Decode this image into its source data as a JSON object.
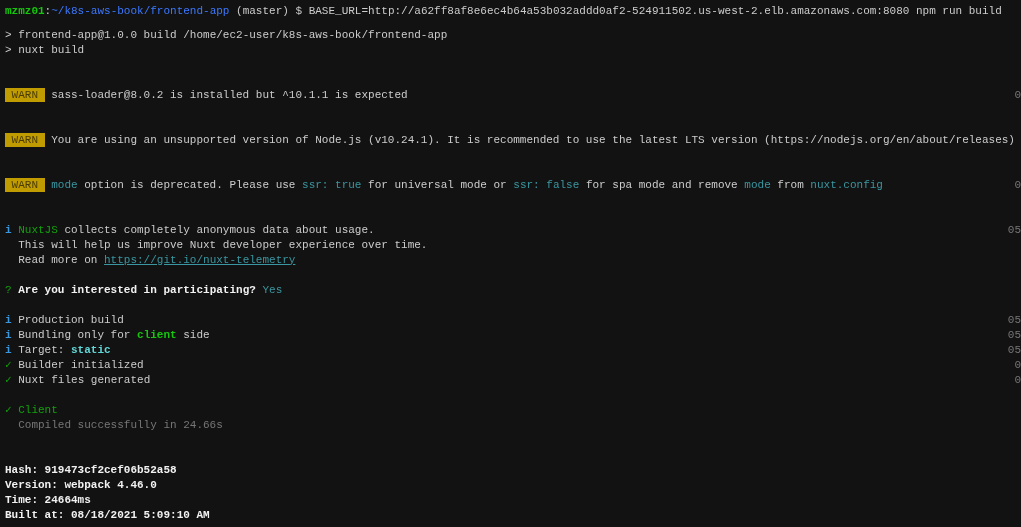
{
  "terminal": {
    "blocks": [
      {
        "kind": "prompt",
        "lines": [
          {
            "segments": [
              {
                "text": "mzmz01",
                "kind": "user"
              },
              {
                "text": ":",
                "kind": "plain"
              },
              {
                "text": "~/k8s-aws-book/frontend-app",
                "kind": "path"
              },
              {
                "text": " (master) $ BASE_URL=http://a62ff8af8e6ec4b64a53b032addd0af2-524911502.us-west-2.elb.amazonaws.com:8080 npm run build",
                "kind": "plain"
              }
            ]
          }
        ]
      },
      {
        "kind": "output",
        "lines": [
          {
            "segments": [
              {
                "text": "> frontend-app@1.0.0 build /home/ec2-user/k8s-aws-book/frontend-app",
                "kind": "plain"
              }
            ]
          },
          {
            "segments": [
              {
                "text": "> nuxt build",
                "kind": "plain"
              }
            ]
          }
        ]
      },
      {
        "kind": "warning",
        "lines": [
          {
            "badge": "WARN",
            "segments": [
              {
                "text": "sass-loader@8.0.2 is installed but ^10.1.1 is expected",
                "kind": "plain"
              }
            ],
            "timestamp": "0"
          }
        ]
      },
      {
        "kind": "warning",
        "lines": [
          {
            "badge": "WARN",
            "segments": [
              {
                "text": "You are using an unsupported version of Node.js (v10.24.1). It is recommended to use the latest LTS version (https://nodejs.org/en/about/releases)",
                "kind": "plain"
              }
            ]
          }
        ]
      },
      {
        "kind": "warning",
        "lines": [
          {
            "badge": "WARN",
            "segments": [
              {
                "text": "mode",
                "kind": "accent"
              },
              {
                "text": " option is deprecated. Please use ",
                "kind": "plain"
              },
              {
                "text": "ssr: true",
                "kind": "accent"
              },
              {
                "text": " for universal mode or ",
                "kind": "plain"
              },
              {
                "text": "ssr: false",
                "kind": "accent"
              },
              {
                "text": " for spa mode and remove ",
                "kind": "plain"
              },
              {
                "text": "mode",
                "kind": "accent"
              },
              {
                "text": " from ",
                "kind": "plain"
              },
              {
                "text": "nuxt.config",
                "kind": "accent"
              }
            ],
            "timestamp": "0"
          }
        ]
      },
      {
        "kind": "notice",
        "lines": [
          {
            "marker": {
              "kind": "info",
              "text": "i"
            },
            "segments": [
              {
                "text": "NuxtJS",
                "kind": "success"
              },
              {
                "text": " collects completely anonymous data about usage.",
                "kind": "plain"
              }
            ],
            "timestamp": "05"
          },
          {
            "indent": true,
            "segments": [
              {
                "text": "This will help us improve Nuxt developer experience over time.",
                "kind": "plain"
              }
            ]
          },
          {
            "indent": true,
            "segments": [
              {
                "text": "Read more on ",
                "kind": "plain"
              },
              {
                "text": "https://git.io/nuxt-telemetry",
                "kind": "link"
              }
            ]
          }
        ]
      },
      {
        "kind": "question",
        "lines": [
          {
            "marker": {
              "kind": "question",
              "text": "?"
            },
            "segments": [
              {
                "text": "Are you interested in participating?",
                "kind": "bold"
              },
              {
                "text": " Yes",
                "kind": "accent"
              }
            ]
          }
        ]
      },
      {
        "kind": "steps",
        "lines": [
          {
            "marker": {
              "kind": "info",
              "text": "i"
            },
            "segments": [
              {
                "text": "Production build",
                "kind": "plain"
              }
            ],
            "timestamp": "05"
          },
          {
            "marker": {
              "kind": "info",
              "text": "i"
            },
            "segments": [
              {
                "text": "Bundling only for ",
                "kind": "plain"
              },
              {
                "text": "client",
                "kind": "green-bold"
              },
              {
                "text": " side",
                "kind": "plain"
              }
            ],
            "timestamp": "05"
          },
          {
            "marker": {
              "kind": "info",
              "text": "i"
            },
            "segments": [
              {
                "text": "Target: ",
                "kind": "plain"
              },
              {
                "text": "static",
                "kind": "cyan-bold"
              }
            ],
            "timestamp": "05"
          },
          {
            "marker": {
              "kind": "check",
              "text": "✓"
            },
            "segments": [
              {
                "text": "Builder initialized",
                "kind": "plain"
              }
            ],
            "timestamp": "0"
          },
          {
            "marker": {
              "kind": "check",
              "text": "✓"
            },
            "segments": [
              {
                "text": "Nuxt files generated",
                "kind": "plain"
              }
            ],
            "timestamp": "0"
          }
        ]
      },
      {
        "kind": "success",
        "lines": [
          {
            "marker": {
              "kind": "check",
              "text": "✓"
            },
            "segments": [
              {
                "text": "Client",
                "kind": "success"
              }
            ]
          },
          {
            "indent": true,
            "segments": [
              {
                "text": "Compiled successfully in 24.66s",
                "kind": "dim"
              }
            ]
          }
        ]
      },
      {
        "kind": "stats",
        "lines": [
          {
            "segments": [
              {
                "text": "Hash: 919473cf2cef06b52a58",
                "kind": "bold"
              }
            ]
          },
          {
            "segments": [
              {
                "text": "Version: webpack 4.46.0",
                "kind": "bold"
              }
            ]
          },
          {
            "segments": [
              {
                "text": "Time: 24664ms",
                "kind": "bold"
              }
            ]
          },
          {
            "segments": [
              {
                "text": "Built at: 08/18/2021 5:09:10 AM",
                "kind": "bold"
              }
            ]
          }
        ]
      }
    ]
  }
}
